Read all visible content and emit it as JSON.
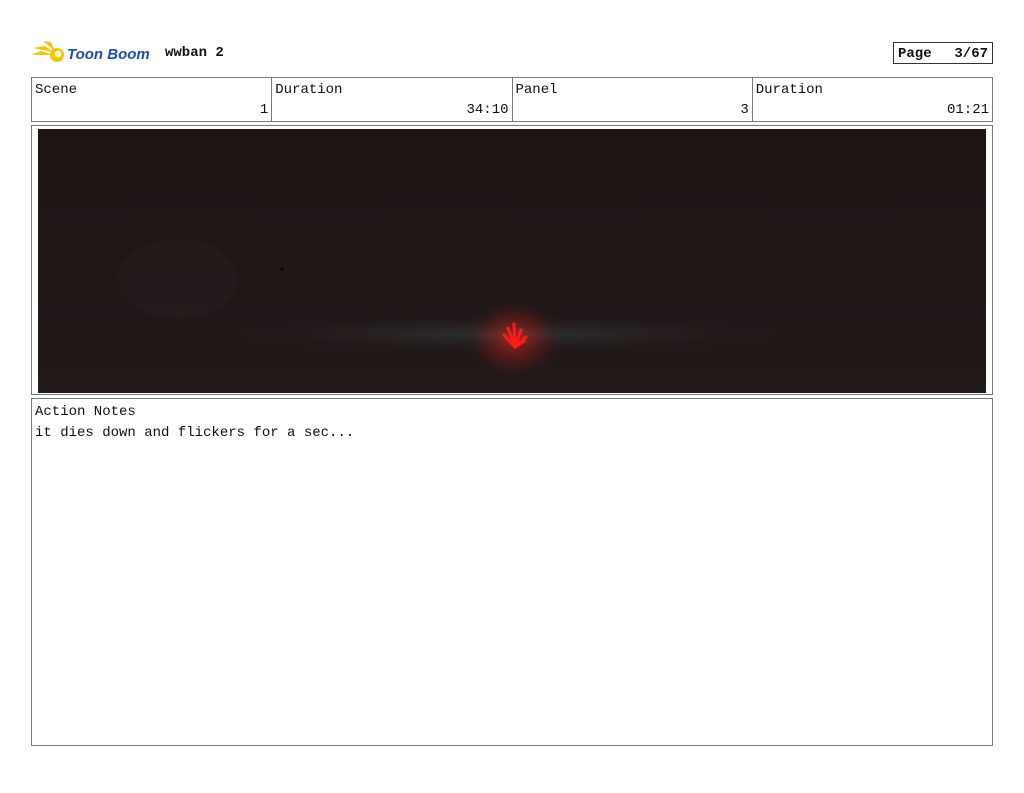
{
  "header": {
    "logo_text": "Toon Boom",
    "project_name": "wwban 2",
    "page_label": "Page",
    "page_value": "3/67"
  },
  "info": {
    "scene_label": "Scene",
    "scene_value": "1",
    "scene_duration_label": "Duration",
    "scene_duration_value": "34:10",
    "panel_label": "Panel",
    "panel_value": "3",
    "panel_duration_label": "Duration",
    "panel_duration_value": "01:21"
  },
  "panel_image": {
    "icon": "hand-pointing-down-icon",
    "background_color": "#1f1515",
    "accent_color": "#ff1a1a"
  },
  "notes": {
    "title": "Action Notes",
    "text": "it dies down and flickers for a sec..."
  },
  "colors": {
    "logo_yellow": "#f5c400",
    "logo_blue": "#1e4fa8",
    "border": "#777777"
  }
}
